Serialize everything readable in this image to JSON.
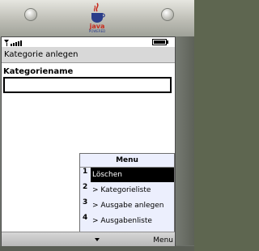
{
  "device": {
    "brand_logo_text": "java",
    "brand_logo_sub": "POWERED",
    "left_button_icon": "device-left-button-icon",
    "right_button_icon": "device-right-button-icon"
  },
  "status": {
    "signal_icon": "signal-strength-icon",
    "battery_icon": "battery-icon"
  },
  "form": {
    "title": "Kategorie anlegen",
    "field_label": "Kategoriename",
    "field_value": ""
  },
  "menu": {
    "title": "Menu",
    "items": [
      {
        "number": "1",
        "label": "Löschen",
        "selected": true
      },
      {
        "number": "2",
        "label": "> Kategorieliste",
        "selected": false
      },
      {
        "number": "3",
        "label": "> Ausgabe anlegen",
        "selected": false
      },
      {
        "number": "4",
        "label": "> Ausgabenliste",
        "selected": false
      }
    ]
  },
  "softkeys": {
    "right_label": "Menu",
    "center_icon": "down-arrow-icon"
  }
}
